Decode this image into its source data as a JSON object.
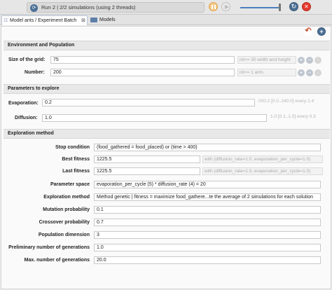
{
  "toolbar": {
    "run_label": "Run 2 | 2/2 simulations (using 2 threads)",
    "pause_state": "active",
    "speed_slider_value": 0.95
  },
  "tabs": [
    {
      "label": "Model ants / Experiment Batch",
      "close": "⊠",
      "active": true
    },
    {
      "label": "Models",
      "active": false
    }
  ],
  "sections": {
    "environment": "Environment and Population",
    "explore": "Parameters to explore",
    "method": "Exploration method"
  },
  "params": {
    "grid_label": "Size of the grid:",
    "grid_value": "75",
    "grid_hint": "int>= 30 width and height",
    "number_label": "Number:",
    "number_value": "200",
    "number_hint": "int>= 1 ants",
    "evap_label": "Evaporation:",
    "evap_value": "0.2",
    "evap_hint": "000.2 [0.0..240.0] every 2.4",
    "diff_label": "Diffusion:",
    "diff_value": "1.0",
    "diff_hint": "1.0 [0.1..1.0] every 0.3"
  },
  "method": {
    "stop_label": "Stop condition",
    "stop_value": "(food_gathered = food_placed) or (time > 400)",
    "best_label": "Best fitness",
    "best_value": "1225.5",
    "best_hint": "with (diffusion_rate=1.0, evaporation_per_cycle=1.0)",
    "last_label": "Last fitness",
    "last_value": "1225.5",
    "last_hint": "with (diffusion_rate=1.0, evaporation_per_cycle=1.0)",
    "space_label": "Parameter space",
    "space_value": "evaporation_per_cycle (5) * diffusion_rate (4)  = 20",
    "expl_label": "Exploration method",
    "expl_value": "Method genetic | fitness =  maximize food_gathere...te the average of 2 simulations for each solution",
    "mut_label": "Mutation probability",
    "mut_value": "0.1",
    "cross_label": "Crossover probability",
    "cross_value": "0.7",
    "pop_label": "Population dimension",
    "pop_value": "3",
    "pre_label": "Preliminary number of generations",
    "pre_value": "1.0",
    "max_label": "Max. number of generations",
    "max_value": "20.0"
  },
  "colors": {
    "accent": "#4b6f93",
    "stop": "#e53a2e",
    "pause": "#f3c98a"
  }
}
